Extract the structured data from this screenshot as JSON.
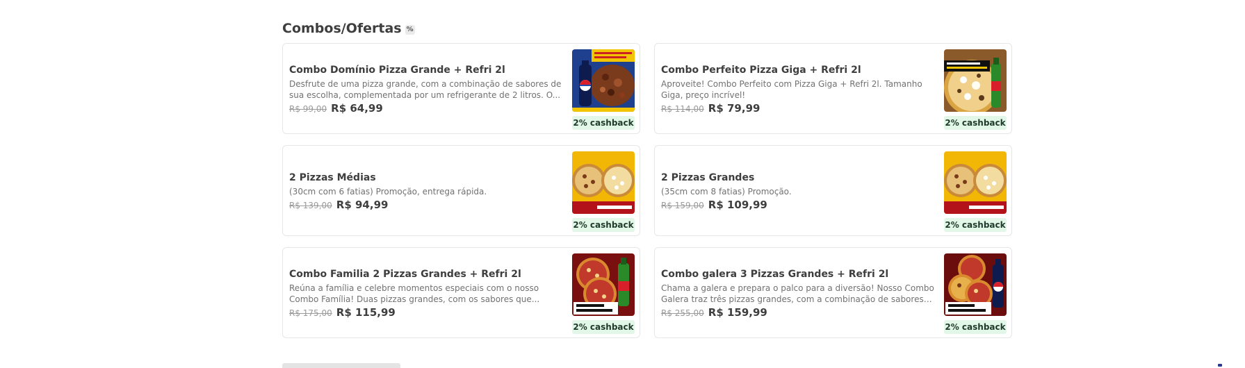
{
  "section": {
    "title": "Combos/Ofertas",
    "icon": "percent-icon",
    "icon_glyph": "%"
  },
  "cards": [
    {
      "name": "Combo Domínio Pizza Grande + Refri 2l",
      "description": "Desfrute de uma pizza grande, com a combinação de sabores de sua escolha, complementada por um refrigerante de 2 litros. O...",
      "old_price": "R$ 99,00",
      "price": "R$ 64,99",
      "cashback": "2% cashback",
      "image": "combo-dominio-image"
    },
    {
      "name": "Combo Perfeito Pizza Giga + Refri 2l",
      "description": "Aproveite! Combo Perfeito com Pizza Giga + Refri 2l. Tamanho Giga, preço incrível!",
      "old_price": "R$ 114,00",
      "price": "R$ 79,99",
      "cashback": "2% cashback",
      "image": "combo-perfeito-image"
    },
    {
      "name": "2 Pizzas Médias",
      "description": "(30cm com 6 fatias) Promoção, entrega rápida.",
      "old_price": "R$ 139,00",
      "price": "R$ 94,99",
      "cashback": "2% cashback",
      "image": "two-medium-pizzas-image"
    },
    {
      "name": "2 Pizzas Grandes",
      "description": "(35cm com 8 fatias) Promoção.",
      "old_price": "R$ 159,00",
      "price": "R$ 109,99",
      "cashback": "2% cashback",
      "image": "two-large-pizzas-image"
    },
    {
      "name": "Combo Familia 2 Pizzas Grandes + Refri 2l",
      "description": "Reúna a família e celebre momentos especiais com o nosso Combo Família! Duas pizzas grandes, com os sabores que...",
      "old_price": "R$ 175,00",
      "price": "R$ 115,99",
      "cashback": "2% cashback",
      "image": "combo-familia-image"
    },
    {
      "name": "Combo galera 3 Pizzas Grandes + Refri 2l",
      "description": "Chama a galera e prepara o palco para a diversão! Nosso Combo Galera traz três pizzas grandes, com a combinação de sabores qu...",
      "old_price": "R$ 255,00",
      "price": "R$ 159,99",
      "cashback": "2% cashback",
      "image": "combo-galera-image"
    }
  ],
  "colors": {
    "cashback_bg": "#e3f7e8",
    "text": "#3e3e3e",
    "muted": "#717171"
  }
}
